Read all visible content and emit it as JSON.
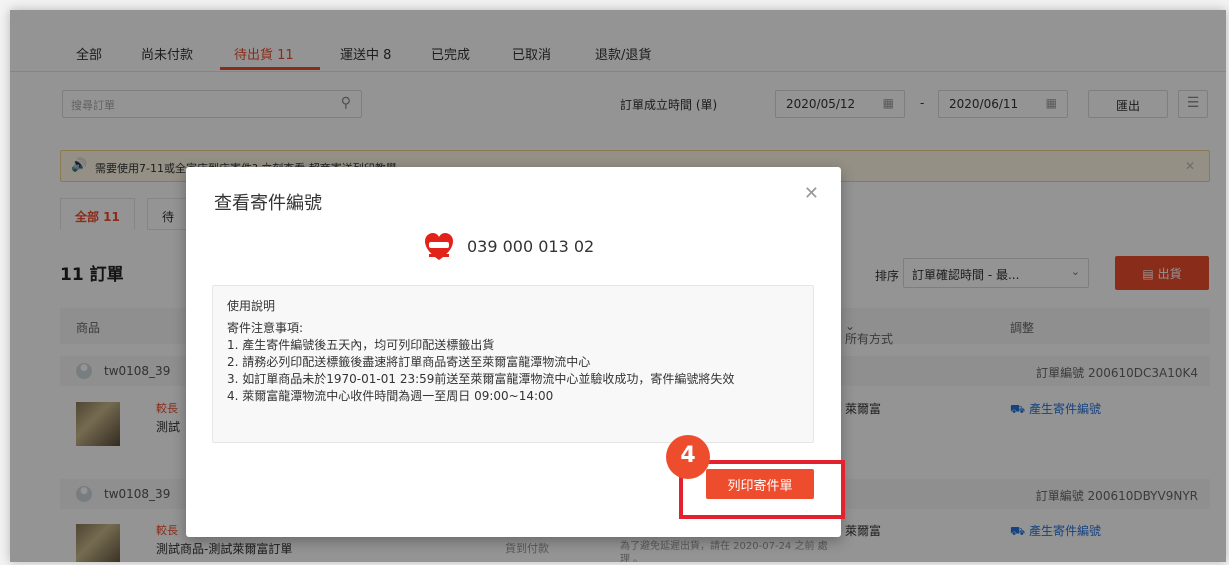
{
  "status_tabs": [
    {
      "label": "全部"
    },
    {
      "label": "尚未付款"
    },
    {
      "label": "待出貨 11"
    },
    {
      "label": "運送中 8"
    },
    {
      "label": "已完成"
    },
    {
      "label": "已取消"
    },
    {
      "label": "退款/退貨"
    }
  ],
  "active_tab_index": 2,
  "filters": {
    "search_placeholder": "搜尋訂單",
    "date_label": "訂單成立時間 (單)",
    "date_from": "2020/05/12",
    "date_to": "2020/06/11",
    "date_separator": "-",
    "export_label": "匯出"
  },
  "notice": {
    "text": "需要使用7-11或全家店到店寄件? 立刻查看 超商寄送列印教學"
  },
  "sub_tabs": [
    {
      "label": "全部 11"
    },
    {
      "label": "待"
    }
  ],
  "order_count_title": "11 訂單",
  "sort": {
    "label": "排序",
    "value": "訂單確認時間 - 最..."
  },
  "ship_button": "出貨",
  "table_headers": {
    "product": "商品",
    "shipping_method": "所有方式",
    "adjust": "調整"
  },
  "orders": [
    {
      "user": "tw0108_39",
      "order_no": "訂單編號 200610DC3A10K4",
      "tag": "較長",
      "product": "測試",
      "carrier": "萊爾富",
      "action": "產生寄件編號"
    },
    {
      "user": "tw0108_39",
      "order_no": "訂單編號 200610DBYV9NYR",
      "tag": "較長",
      "product": "測試商品-測試萊爾富訂單",
      "payment": "貨到付款",
      "note": "為了避免延遲出貨，請在 2020-07-24 之前 處理 。",
      "carrier": "萊爾富",
      "action": "產生寄件編號"
    }
  ],
  "modal": {
    "title": "查看寄件編號",
    "tracking_number": "039 000 013 02",
    "instructions_title": "使用說明",
    "instructions_subtitle": "寄件注意事項:",
    "instructions": [
      "1. 產生寄件編號後五天內，均可列印配送標籤出貨",
      "2. 請務必列印配送標籤後盡速將訂單商品寄送至萊爾富龍潭物流中心",
      "3. 如訂單商品未於1970-01-01 23:59前送至萊爾富龍潭物流中心並驗收成功，寄件編號將失效",
      "4. 萊爾富龍潭物流中心收件時間為週一至周日 09:00~14:00"
    ],
    "print_button": "列印寄件單"
  },
  "step_badge": "4",
  "colors": {
    "accent": "#ee4d2d",
    "highlight": "#e5202f",
    "link": "#2673dd"
  }
}
